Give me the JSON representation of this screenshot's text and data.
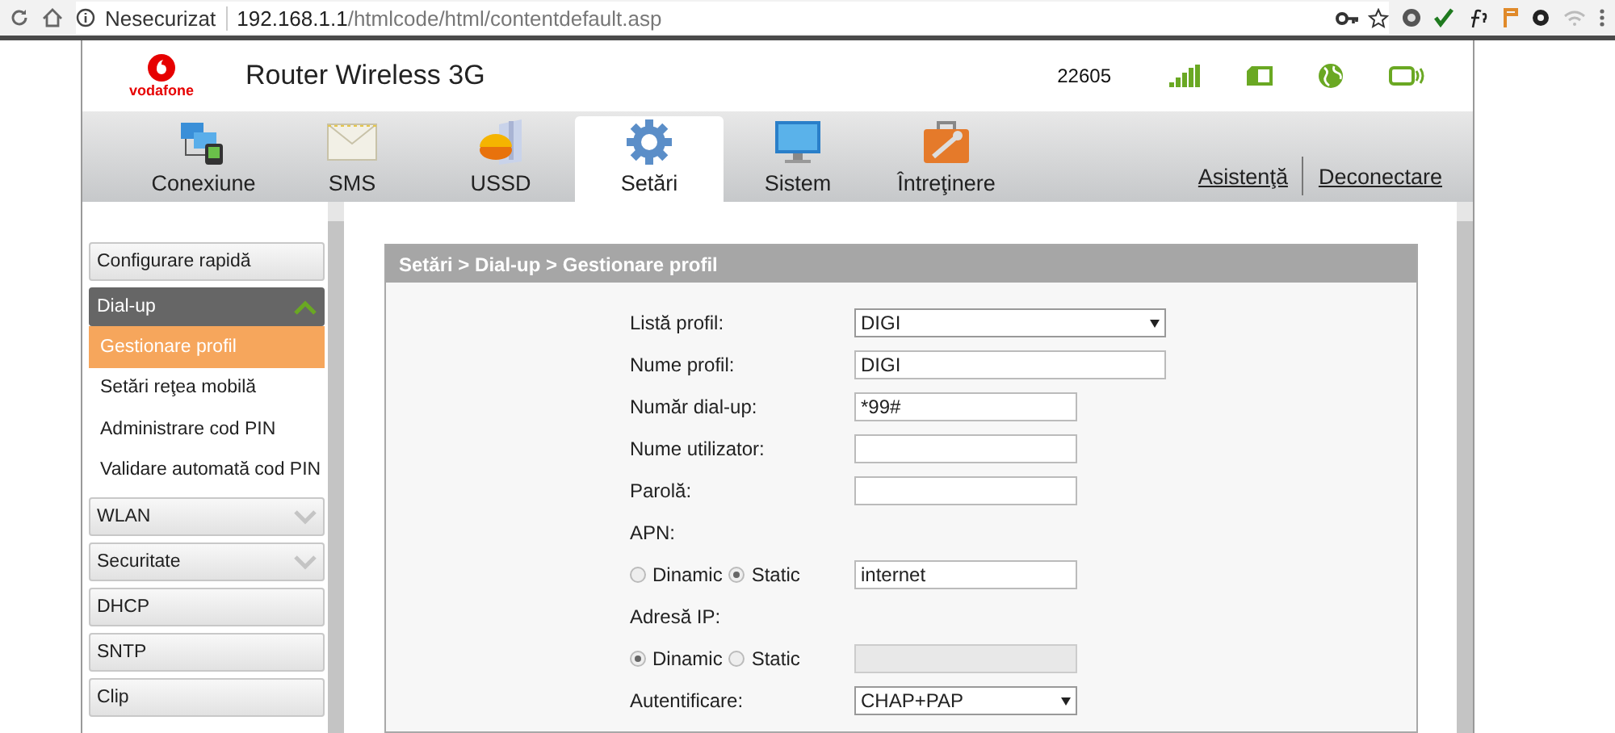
{
  "browser": {
    "security": "Nesecurizat",
    "url_host": "192.168.1.1",
    "url_path": "/htmlcode/html/contentdefault.asp"
  },
  "header": {
    "brand": "vodafone",
    "title": "Router Wireless 3G",
    "code": "22605"
  },
  "tabs": [
    {
      "label": "Conexiune",
      "selected": false
    },
    {
      "label": "SMS",
      "selected": false
    },
    {
      "label": "USSD",
      "selected": false
    },
    {
      "label": "Setări",
      "selected": true
    },
    {
      "label": "Sistem",
      "selected": false
    },
    {
      "label": "Întreţinere",
      "selected": false
    }
  ],
  "links": [
    "Asistenţă",
    "Deconectare"
  ],
  "sidebar": {
    "items": [
      {
        "label": "Configurare rapidă",
        "kind": "link"
      },
      {
        "label": "Dial-up",
        "kind": "group",
        "expanded": true,
        "children": [
          {
            "label": "Gestionare profil",
            "selected": true
          },
          {
            "label": "Setări reţea mobilă",
            "selected": false
          },
          {
            "label": "Administrare cod PIN",
            "selected": false
          },
          {
            "label": "Validare automată cod PIN",
            "selected": false
          }
        ]
      },
      {
        "label": "WLAN",
        "kind": "group",
        "expanded": false
      },
      {
        "label": "Securitate",
        "kind": "group",
        "expanded": false
      },
      {
        "label": "DHCP",
        "kind": "link"
      },
      {
        "label": "SNTP",
        "kind": "link"
      },
      {
        "label": "Clip",
        "kind": "link"
      }
    ]
  },
  "panel": {
    "breadcrumb": "Setări > Dial-up > Gestionare profil",
    "rows": [
      {
        "kind": "select",
        "label": "Listă profil:",
        "value": "DIGI",
        "wide": true
      },
      {
        "kind": "text",
        "label": "Nume profil:",
        "value": "DIGI",
        "wide": true
      },
      {
        "kind": "text",
        "label": "Număr dial-up:",
        "value": "*99#",
        "wide": false
      },
      {
        "kind": "text",
        "label": "Nume utilizator:",
        "wide": false
      },
      {
        "kind": "text",
        "label": "Parolă:",
        "wide": false
      },
      {
        "kind": "heading",
        "label": "APN:"
      },
      {
        "kind": "radio",
        "options": [
          {
            "label": "Dinamic",
            "selected": false
          },
          {
            "label": "Static",
            "selected": true
          }
        ],
        "value": "internet",
        "disabled": false
      },
      {
        "kind": "heading",
        "label": "Adresă IP:"
      },
      {
        "kind": "radio",
        "options": [
          {
            "label": "Dinamic",
            "selected": true
          },
          {
            "label": "Static",
            "selected": false
          }
        ],
        "disabled": true
      },
      {
        "kind": "select",
        "label": "Autentificare:",
        "value": "CHAP+PAP",
        "wide": false
      }
    ]
  }
}
